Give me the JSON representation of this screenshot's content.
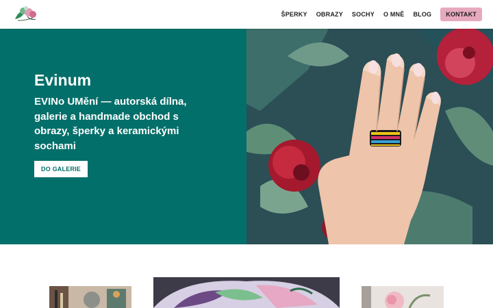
{
  "header": {
    "logo_icon": "flowers-logo-icon",
    "nav": [
      {
        "label": "ŠPERKY"
      },
      {
        "label": "OBRAZY"
      },
      {
        "label": "SOCHY"
      },
      {
        "label": "O MNĚ"
      },
      {
        "label": "BLOG"
      }
    ],
    "cta_label": "KONTAKT"
  },
  "hero": {
    "title": "Evinum",
    "subtitle": "EVINo UMění — autorská dílna, galerie a handmade obchod s obrazy, šperky a keramickými sochami",
    "button_label": "DO GALERIE",
    "image": "hand-with-beaded-ring-photo"
  },
  "colors": {
    "teal": "#036f6a",
    "pink_button": "#e7a9bd",
    "nav_text": "#1e1e1e"
  },
  "gallery": {
    "images": [
      "craft-tools-photo",
      "painted-plate-photo",
      "flower-photo"
    ]
  }
}
